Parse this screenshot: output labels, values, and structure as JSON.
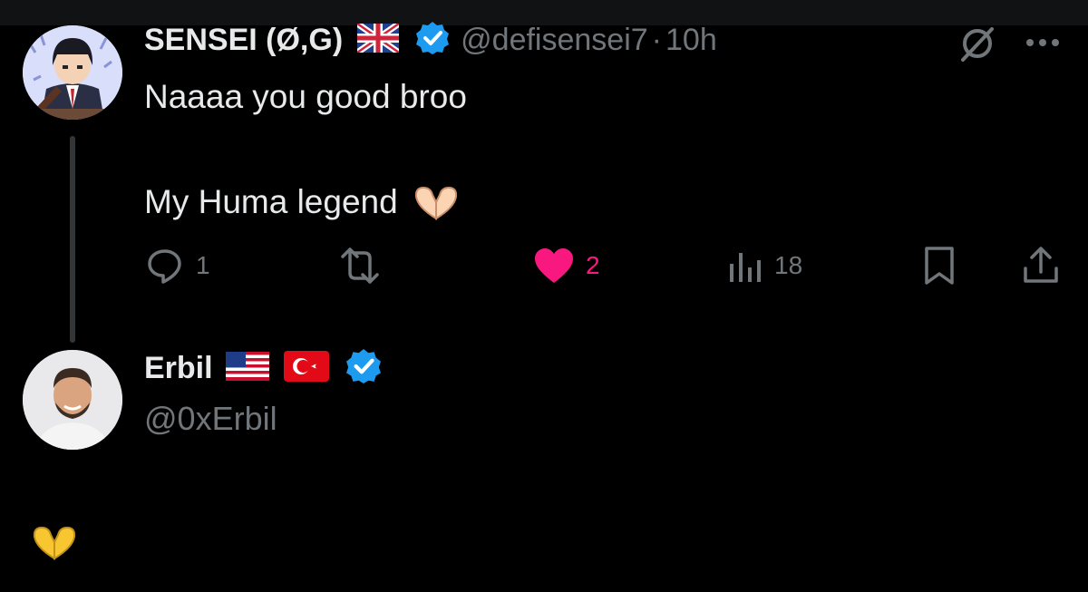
{
  "tweet": {
    "author_name": "SENSEI (Ø,G)",
    "handle": "@defisensei7",
    "separator": "·",
    "time": "10h",
    "text_line1": "Naaaa you good broo",
    "text_line2": "My Huma legend",
    "replies": "1",
    "likes": "2",
    "views": "18"
  },
  "reply_author": {
    "name": "Erbil",
    "handle": "@0xErbil"
  },
  "colors": {
    "background": "#000000",
    "text": "#e7e9ea",
    "muted": "#71767b",
    "like": "#f91880",
    "verified": "#1d9bf0"
  }
}
